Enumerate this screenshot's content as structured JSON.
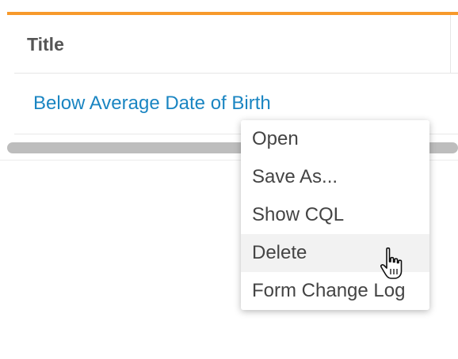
{
  "table": {
    "header_title": "Title",
    "rows": [
      {
        "title": "Below Average Date of Birth"
      }
    ]
  },
  "context_menu": {
    "items": [
      "Open",
      "Save As...",
      "Show CQL",
      "Delete",
      "Form Change Log"
    ],
    "hovered_item": "Delete"
  },
  "colors": {
    "accent": "#f7992b",
    "link": "#1a85c2",
    "header_text": "#555555",
    "menu_text": "#444444",
    "menu_hover": "#f2f2f2",
    "scrollbar_thumb": "#bdbdbd"
  },
  "icons": {
    "cursor": "hand-pointer-icon"
  }
}
